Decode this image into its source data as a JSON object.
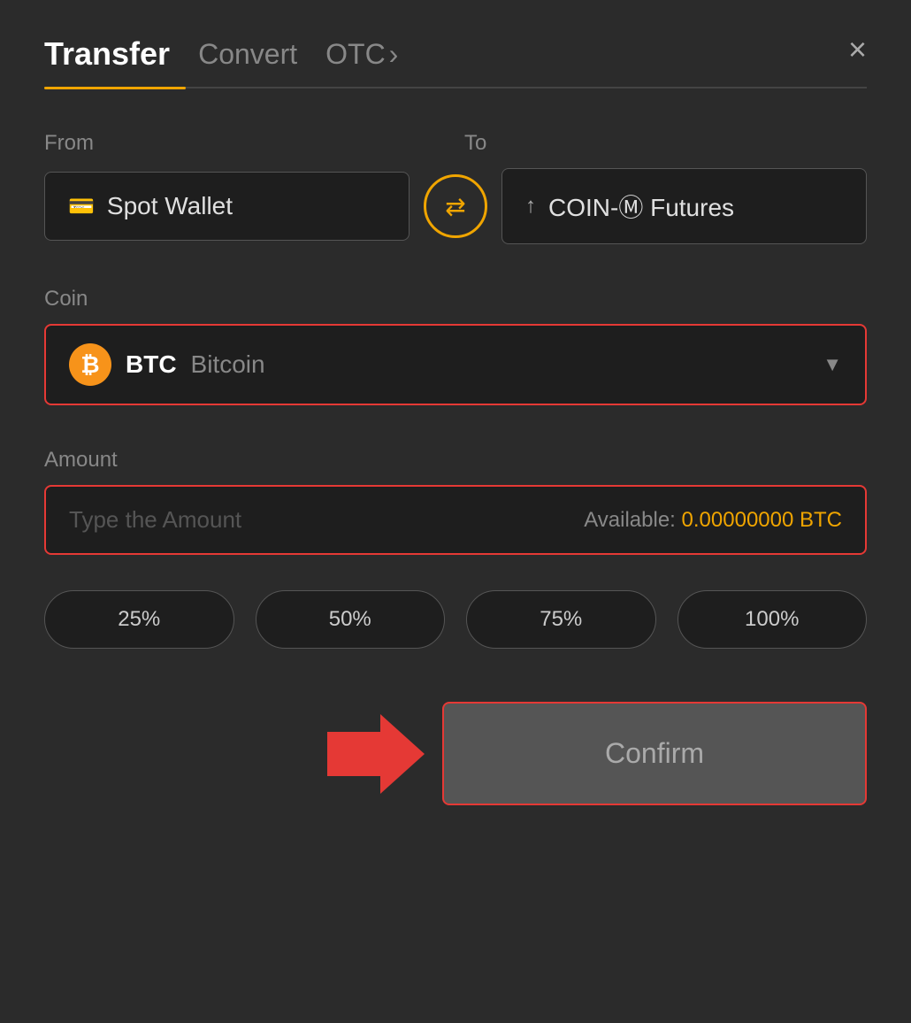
{
  "header": {
    "tab_transfer": "Transfer",
    "tab_convert": "Convert",
    "tab_otc": "OTC",
    "tab_otc_chevron": "›",
    "close": "×"
  },
  "from": {
    "label": "From",
    "wallet_icon": "💳",
    "wallet_name": "Spot Wallet"
  },
  "swap": {
    "icon": "⇄"
  },
  "to": {
    "label": "To",
    "wallet_icon": "↑",
    "wallet_name": "COIN-Ⓜ Futures"
  },
  "coin": {
    "label": "Coin",
    "symbol": "BTC",
    "name": "Bitcoin",
    "chevron": "▼"
  },
  "amount": {
    "label": "Amount",
    "placeholder": "Type the Amount",
    "available_label": "Available:",
    "available_value": "0.00000000 BTC"
  },
  "percent_buttons": [
    {
      "label": "25%"
    },
    {
      "label": "50%"
    },
    {
      "label": "75%"
    },
    {
      "label": "100%"
    }
  ],
  "confirm": {
    "label": "Confirm"
  }
}
